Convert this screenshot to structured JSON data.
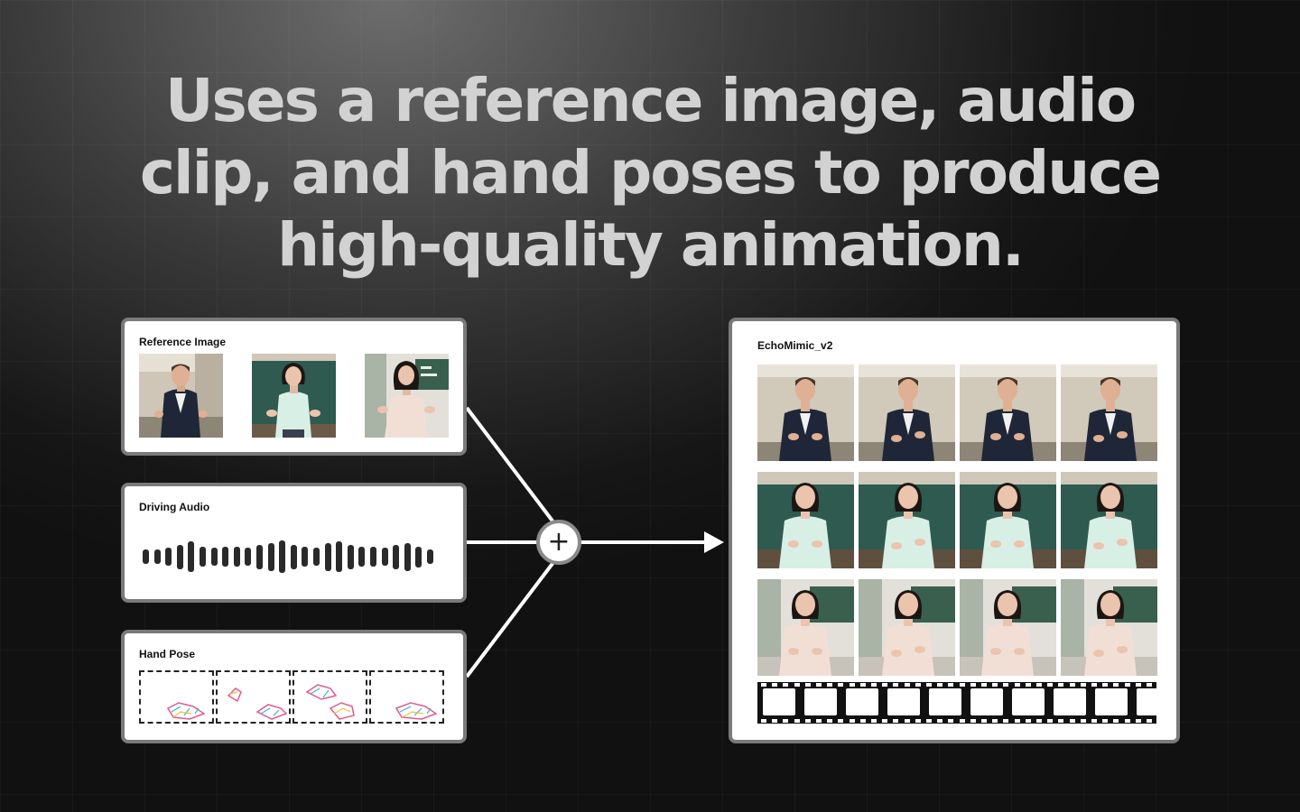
{
  "headline": {
    "line1": "Uses a reference image, audio",
    "line2": "clip, and hand poses to produce",
    "line3": "high-quality animation."
  },
  "reference_image": {
    "title": "Reference Image",
    "subjects": [
      "man-dark-blazer",
      "woman-mint-blouse",
      "woman-pink-blouse"
    ]
  },
  "driving_audio": {
    "title": "Driving Audio",
    "waveform": [
      0.45,
      0.45,
      0.55,
      0.75,
      0.95,
      0.6,
      0.55,
      0.6,
      0.6,
      0.55,
      0.75,
      0.85,
      1.0,
      0.75,
      0.6,
      0.55,
      0.85,
      0.95,
      0.75,
      0.6,
      0.6,
      0.55,
      0.75,
      0.85,
      0.65,
      0.45
    ]
  },
  "hand_pose": {
    "title": "Hand Pose",
    "poses": 4
  },
  "output": {
    "title": "EchoMimic_v2",
    "rows": [
      "man-dark-blazer",
      "woman-mint-blouse",
      "woman-pink-blouse"
    ],
    "frames_per_row": 4
  },
  "combine_icon": "plus-icon",
  "arrow_icon": "arrow-right-icon",
  "colors": {
    "card_border": "#7a7a7a",
    "headline": "#d2d2d2",
    "connector": "#ffffff"
  }
}
